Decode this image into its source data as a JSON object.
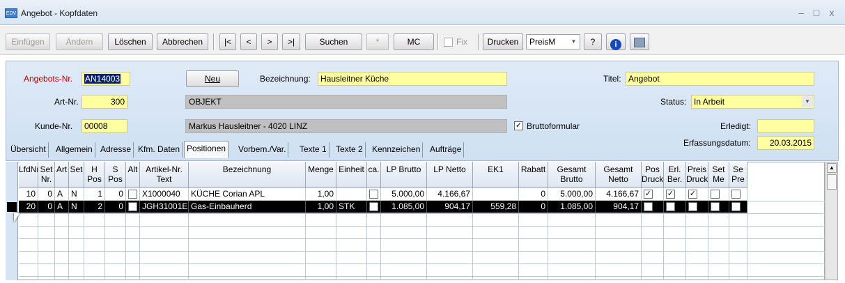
{
  "window": {
    "title": "Angebot - Kopfdaten",
    "app_icon": "EDV",
    "min_glyph": "–",
    "max_glyph": "□",
    "close_glyph": "x"
  },
  "toolbar": {
    "einfuegen": "Einfügen",
    "aendern": "Ändern",
    "loeschen": "Löschen",
    "abbrechen": "Abbrechen",
    "first": "|<",
    "prev": "<",
    "next": ">",
    "last": ">|",
    "suchen": "Suchen",
    "star": "*",
    "mc": "MC",
    "fix": "Fix",
    "drucken": "Drucken",
    "preis_select": "PreisM",
    "help": "?",
    "info": "i"
  },
  "header": {
    "angebots_nr_label": "Angebots-Nr.",
    "angebots_nr": "AN14003",
    "neu": "Neu",
    "bezeichnung_label": "Bezeichnung:",
    "bezeichnung": "Hausleitner Küche",
    "titel_label": "Titel:",
    "titel": "Angebot",
    "art_nr_label": "Art-Nr.",
    "art_nr": "300",
    "objekt": "OBJEKT",
    "status_label": "Status:",
    "status": "In Arbeit",
    "kunde_nr_label": "Kunde-Nr.",
    "kunde_nr": "00008",
    "kunde_name": "Markus Hausleitner - 4020 LINZ",
    "bruttoformular_label": "Bruttoformular",
    "bruttoformular_checked": "✓",
    "erledigt_label": "Erledigt:",
    "erledigt": "",
    "erfassungsdatum_label": "Erfassungsdatum:",
    "erfassungsdatum": "20.03.2015"
  },
  "tabs": [
    "Übersicht",
    "Allgemein",
    "Adresse",
    "Kfm. Daten",
    "Positionen",
    "Vorbem./Var.",
    "Texte 1",
    "Texte 2",
    "Kennzeichen",
    "Aufträge"
  ],
  "grid": {
    "columns": [
      "LfdNr",
      "Set\nNr.",
      "Art",
      "Set",
      "H\nPos",
      "S\nPos",
      "Alt",
      "Artikel-Nr.\nText",
      "Bezeichnung",
      "Menge",
      "Einheit",
      "ca.",
      "LP Brutto",
      "LP Netto",
      "EK1",
      "Rabatt",
      "Gesamt\nBrutto",
      "Gesamt\nNetto",
      "Pos\nDruck",
      "Erl.\nBer.",
      "Preis\nDruck",
      "Set\nMe",
      "Se\nPre"
    ],
    "rows": [
      {
        "lfdnr": "10",
        "setnr": "0",
        "art": "A",
        "set": "N",
        "hpos": "1",
        "spos": "0",
        "artikel": "X1000040",
        "bez": "KÜCHE Corian APL",
        "menge": "1,00",
        "einheit": "",
        "lpb": "5.000,00",
        "lpn": "4.166,67",
        "ek1": "",
        "rabatt": "0",
        "gb": "5.000,00",
        "gn": "4.166,67"
      },
      {
        "lfdnr": "20",
        "setnr": "0",
        "art": "A",
        "set": "N",
        "hpos": "2",
        "spos": "0",
        "artikel": "JGH31001E",
        "bez": "Gas-Einbauherd",
        "menge": "1,00",
        "einheit": "STK",
        "lpb": "1.085,00",
        "lpn": "904,17",
        "ek1": "559,28",
        "rabatt": "0",
        "gb": "1.085,00",
        "gn": "904,17"
      }
    ],
    "check_glyph": "✓"
  }
}
